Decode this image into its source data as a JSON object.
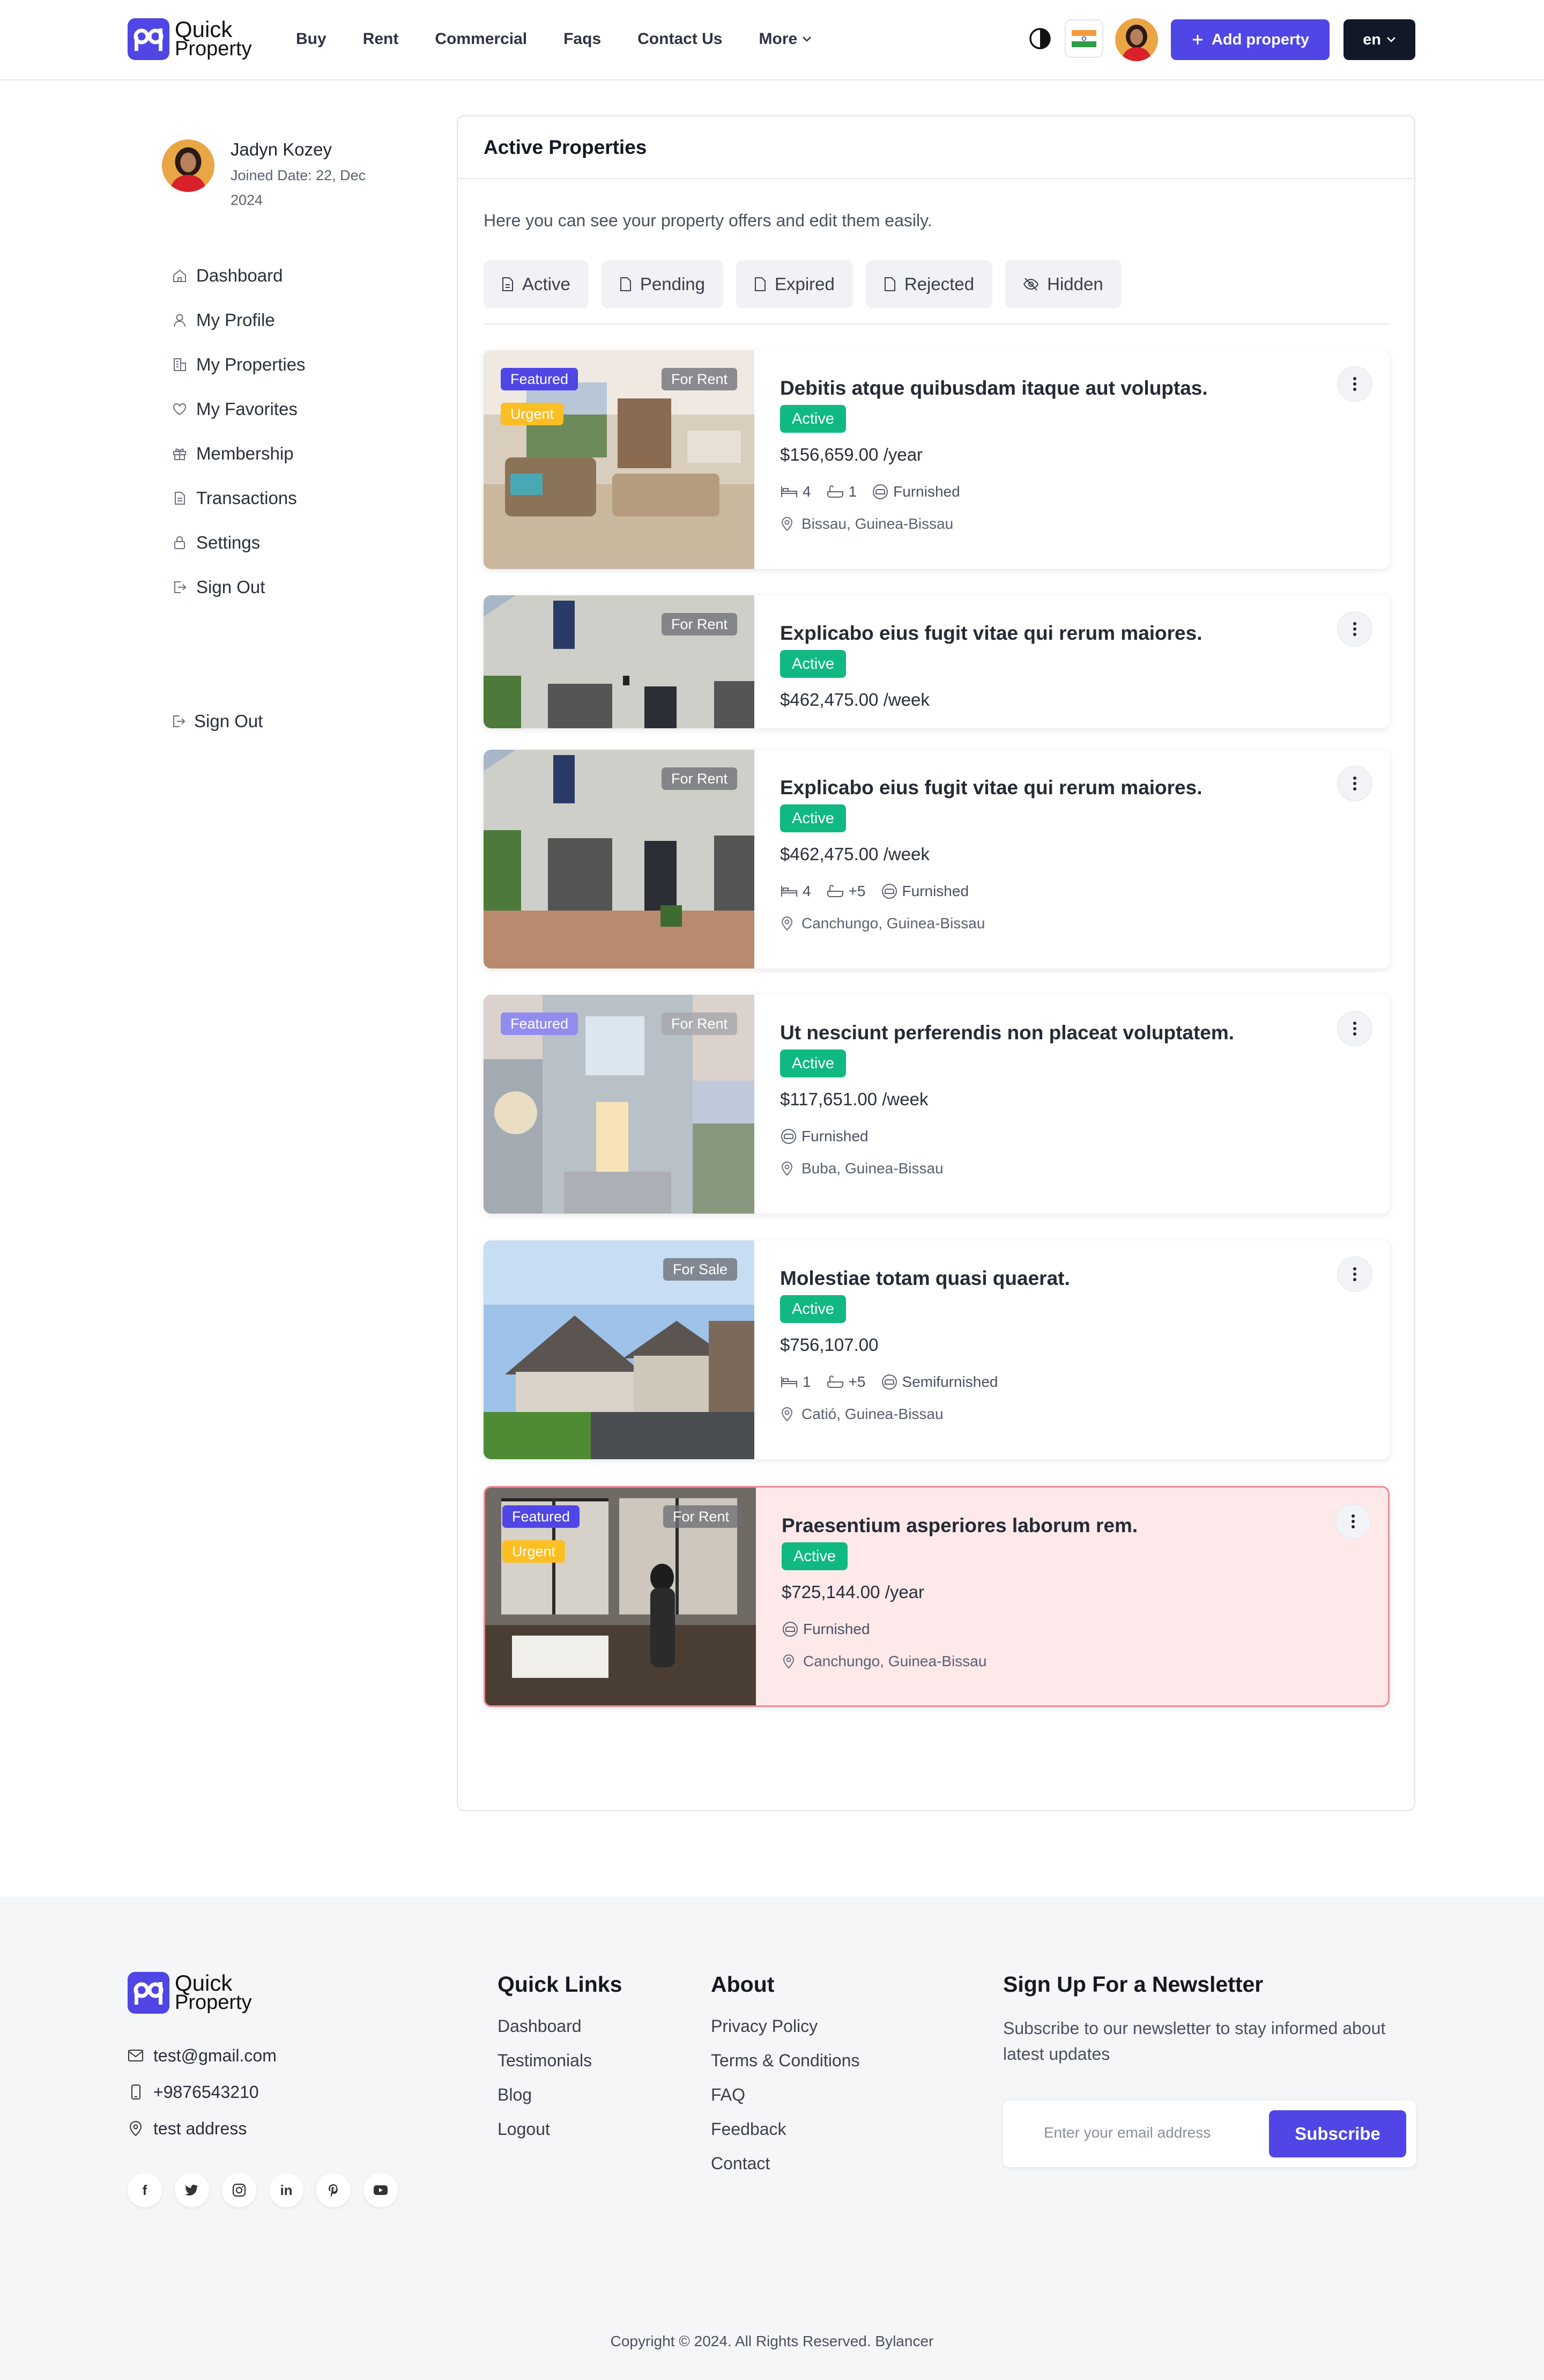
{
  "header": {
    "logo_line1": "Quick",
    "logo_line2": "Property",
    "nav": [
      "Buy",
      "Rent",
      "Commercial",
      "Faqs",
      "Contact Us",
      "More"
    ],
    "add_property": "Add property",
    "language": "en"
  },
  "sidebar": {
    "user_name": "Jadyn Kozey",
    "joined": "Joined Date: 22, Dec 2024",
    "items": [
      "Dashboard",
      "My Profile",
      "My Properties",
      "My Favorites",
      "Membership",
      "Transactions",
      "Settings",
      "Sign Out"
    ],
    "sign_out_2": "Sign Out"
  },
  "main": {
    "title": "Active Properties",
    "intro": "Here you can see your property offers and edit them easily.",
    "tabs": [
      "Active",
      "Pending",
      "Expired",
      "Rejected",
      "Hidden"
    ],
    "properties": [
      {
        "title": "Debitis atque quibusdam itaque aut voluptas.",
        "status": "Active",
        "price": "$156,659.00",
        "period": "/year",
        "beds": "4",
        "baths": "1",
        "furnish": "Furnished",
        "location": "Bissau, Guinea-Bissau",
        "badges": [
          "Featured",
          "Urgent"
        ],
        "type": "For Rent"
      },
      {
        "title": "Explicabo eius fugit vitae qui rerum maiores.",
        "status": "Active",
        "price": "$462,475.00",
        "period": "/week",
        "type": "For Rent"
      },
      {
        "title": "Explicabo eius fugit vitae qui rerum maiores.",
        "status": "Active",
        "price": "$462,475.00",
        "period": "/week",
        "beds": "4",
        "baths": "+5",
        "furnish": "Furnished",
        "location": "Canchungo, Guinea-Bissau",
        "type": "For Rent"
      },
      {
        "title": "Ut nesciunt perferendis non placeat voluptatem.",
        "status": "Active",
        "price": "$117,651.00",
        "period": "/week",
        "furnish": "Furnished",
        "location": "Buba, Guinea-Bissau",
        "badges": [
          "Featured"
        ],
        "type": "For Rent"
      },
      {
        "title": "Molestiae totam quasi quaerat.",
        "status": "Active",
        "price": "$756,107.00",
        "period": "",
        "beds": "1",
        "baths": "+5",
        "furnish": "Semifurnished",
        "location": "Catió, Guinea-Bissau",
        "type": "For Sale"
      },
      {
        "title": "Praesentium asperiores laborum rem.",
        "status": "Active",
        "price": "$725,144.00",
        "period": "/year",
        "furnish": "Furnished",
        "location": "Canchungo, Guinea-Bissau",
        "badges": [
          "Featured",
          "Urgent"
        ],
        "type": "For Rent"
      }
    ]
  },
  "footer": {
    "logo_line1": "Quick",
    "logo_line2": "Property",
    "email": "test@gmail.com",
    "phone": "+9876543210",
    "address": "test address",
    "quick_links_title": "Quick Links",
    "quick_links": [
      "Dashboard",
      "Testimonials",
      "Blog",
      "Logout"
    ],
    "about_title": "About",
    "about_links": [
      "Privacy Policy",
      "Terms & Conditions",
      "FAQ",
      "Feedback",
      "Contact"
    ],
    "newsletter_title": "Sign Up For a Newsletter",
    "newsletter_text": "Subscribe to our newsletter to stay informed about latest updates",
    "email_placeholder": "Enter your email address",
    "subscribe": "Subscribe",
    "social": [
      "facebook-icon",
      "twitter-icon",
      "instagram-icon",
      "linkedin-icon",
      "pinterest-icon",
      "youtube-icon"
    ],
    "copyright": "Copyright © 2024. All Rights Reserved. Bylancer"
  },
  "colors": {
    "primary": "#4f46e5",
    "success": "#10b981",
    "urgent": "#fbbf24",
    "dark": "#111827",
    "highlight_bg": "#fde8ea"
  }
}
